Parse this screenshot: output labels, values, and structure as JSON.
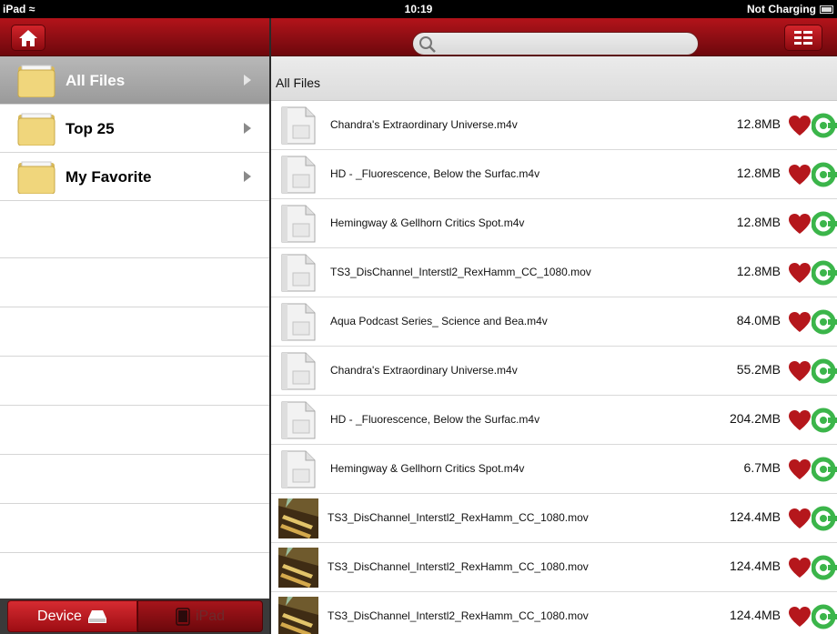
{
  "status_bar": {
    "device": "iPad",
    "time": "10:19",
    "battery": "Not Charging"
  },
  "toolbar": {
    "search_placeholder": ""
  },
  "sidebar": {
    "items": [
      {
        "label": "All Files",
        "selected": true
      },
      {
        "label": "Top 25",
        "selected": false
      },
      {
        "label": "My Favorite",
        "selected": false
      }
    ]
  },
  "bottom_toggle": {
    "device_label": "Device",
    "ipad_label": "iPad",
    "selected": "Device"
  },
  "main": {
    "section_title": "All Files",
    "files": [
      {
        "name": "Chandra's Extraordinary Universe.m4v",
        "size": "12.8MB",
        "thumb": "document-icon"
      },
      {
        "name": "HD - _Fluorescence, Below the Surfac.m4v",
        "size": "12.8MB",
        "thumb": "document-icon"
      },
      {
        "name": "Hemingway & Gellhorn Critics Spot.m4v",
        "size": "12.8MB",
        "thumb": "document-icon"
      },
      {
        "name": "TS3_DisChannel_Interstl2_RexHamm_CC_1080.mov",
        "size": "12.8MB",
        "thumb": "document-icon"
      },
      {
        "name": "Aqua Podcast Series_ Science and Bea.m4v",
        "size": "84.0MB",
        "thumb": "document-icon"
      },
      {
        "name": "Chandra's Extraordinary Universe.m4v",
        "size": "55.2MB",
        "thumb": "document-icon"
      },
      {
        "name": "HD - _Fluorescence, Below the Surfac.m4v",
        "size": "204.2MB",
        "thumb": "document-icon"
      },
      {
        "name": "Hemingway & Gellhorn Critics Spot.m4v",
        "size": "6.7MB",
        "thumb": "document-icon"
      },
      {
        "name": "TS3_DisChannel_Interstl2_RexHamm_CC_1080.mov",
        "size": "124.4MB",
        "thumb": "video-thumbnail"
      },
      {
        "name": "TS3_DisChannel_Interstl2_RexHamm_CC_1080.mov",
        "size": "124.4MB",
        "thumb": "video-thumbnail"
      },
      {
        "name": "TS3_DisChannel_Interstl2_RexHamm_CC_1080.mov",
        "size": "124.4MB",
        "thumb": "video-thumbnail"
      }
    ]
  },
  "colors": {
    "brand_red": "#a3121a",
    "heart": "#b5171c",
    "share_green": "#3bb54a",
    "selected_row": "#a8a8a8"
  }
}
